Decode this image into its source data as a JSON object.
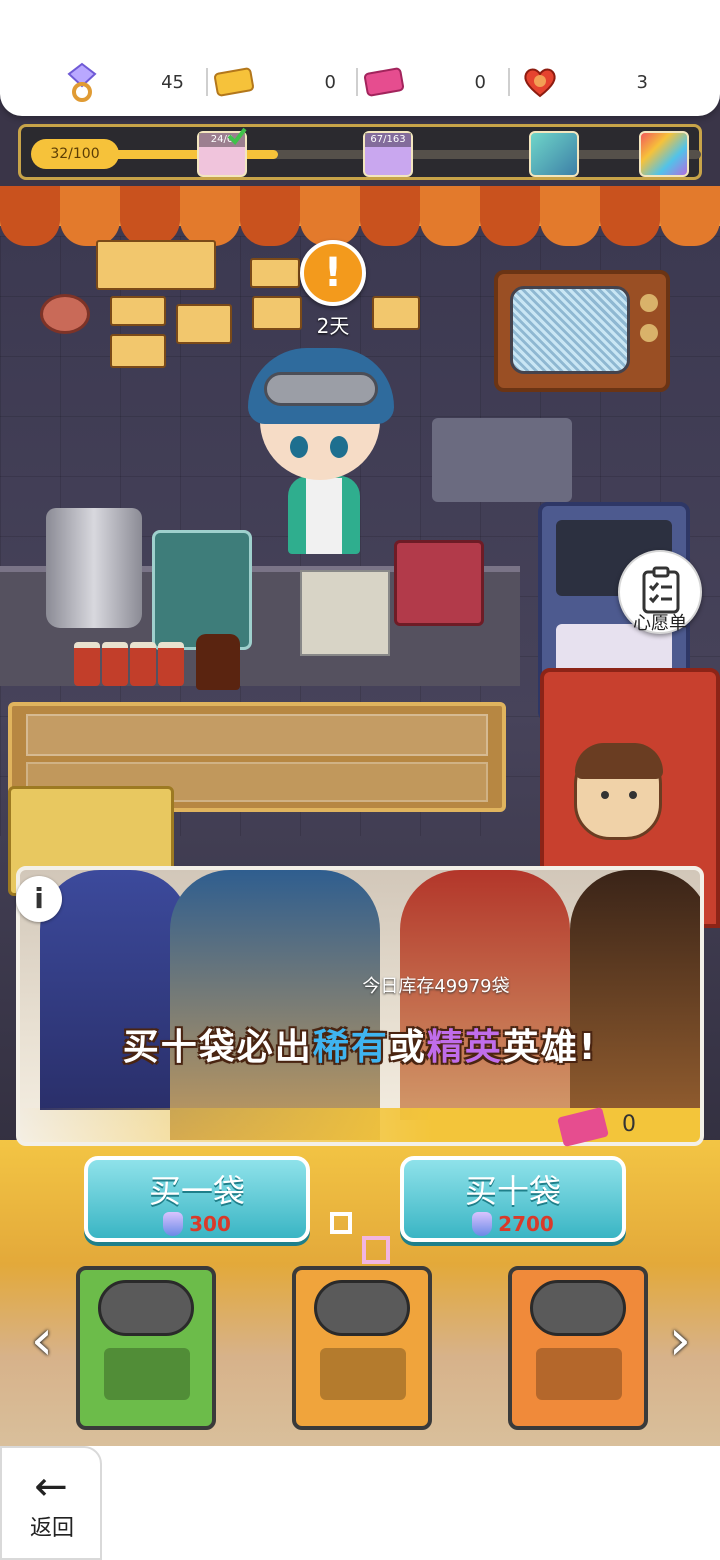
{
  "currencies": [
    {
      "name": "diamond",
      "icon": "diamond-ring-icon",
      "value": "45"
    },
    {
      "name": "gold-ticket",
      "icon": "gold-ticket-icon",
      "value": "0"
    },
    {
      "name": "pink-ticket",
      "icon": "pink-ticket-icon",
      "value": "0"
    },
    {
      "name": "heart-token",
      "icon": "heart-icon",
      "value": "3"
    }
  ],
  "progress": {
    "label": "32/100",
    "current": 32,
    "max": 100,
    "milestones": [
      {
        "label": "24/0",
        "icon": "gift-box-icon",
        "done": true
      },
      {
        "label": "67/163",
        "icon": "purple-box-icon",
        "done": false
      },
      {
        "label": "",
        "icon": "capsule-card-icon",
        "done": false
      },
      {
        "label": "",
        "icon": "rainbow-card-icon",
        "done": false
      }
    ]
  },
  "scene": {
    "alert_symbol": "!",
    "alert_days": "2天",
    "wishlist_label": "心愿单"
  },
  "banner": {
    "info_symbol": "i",
    "stock_text": "今日库存49979袋",
    "slogan_prefix": "买十袋必出",
    "slogan_rare": "稀有",
    "slogan_or": "或",
    "slogan_elite": "精英",
    "slogan_suffix": "英雄!",
    "ticket_count": "0"
  },
  "buy": {
    "one": {
      "label": "买一袋",
      "cost": "300"
    },
    "ten": {
      "label": "买十袋",
      "cost": "2700"
    }
  },
  "bags": [
    {
      "name": "green-bag",
      "color": "#6cbc4a"
    },
    {
      "name": "orange-cat-bag",
      "color": "#f0a43c"
    },
    {
      "name": "heart-cat-bag",
      "color": "#f08a3a"
    }
  ],
  "nav": {
    "prev": "‹",
    "next": "›",
    "back_label": "返回",
    "back_arrow": "←"
  },
  "colors": {
    "accent_gold": "#f6c23a",
    "button_teal": "#3ab5c4",
    "price_red": "#d93a2a",
    "rare_blue": "#3fb4f0",
    "elite_purple": "#c06dea"
  }
}
